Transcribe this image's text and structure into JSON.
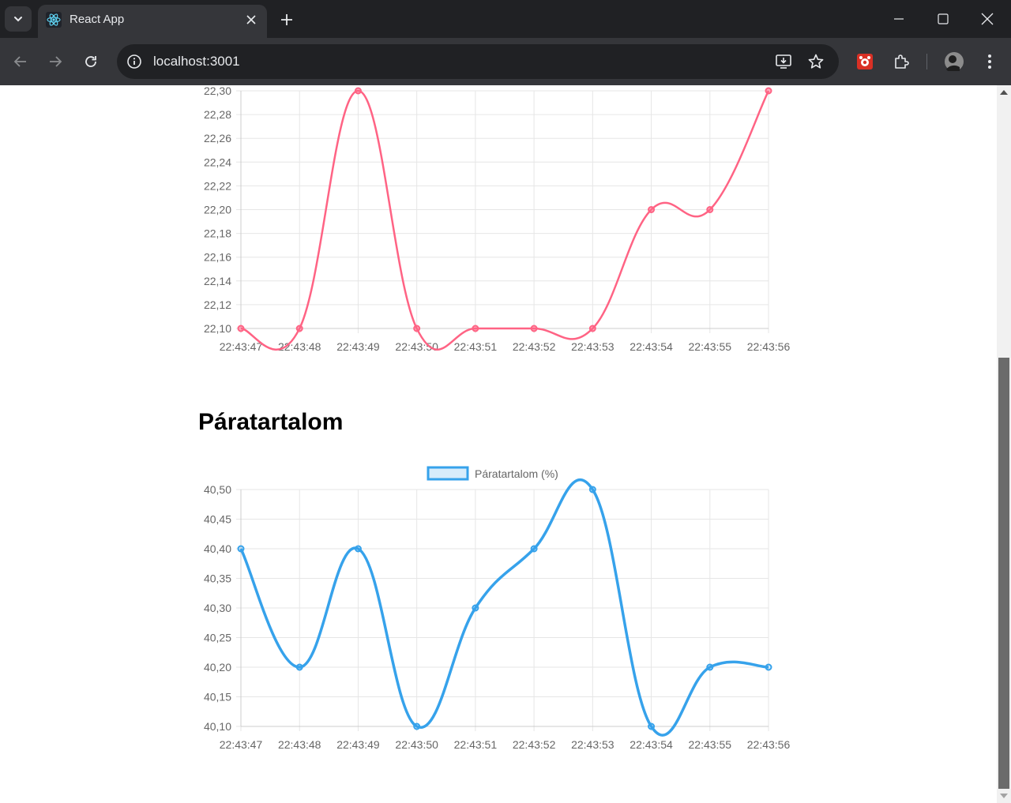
{
  "browser": {
    "tab_title": "React App",
    "url": "localhost:3001"
  },
  "icons": {
    "tab_search": "chevron-down-icon",
    "favicon": "react-icon",
    "tab_close": "close-icon",
    "new_tab": "plus-icon",
    "back": "arrow-left-icon",
    "forward": "arrow-right-icon",
    "reload": "reload-icon",
    "site_info": "info-icon",
    "install": "install-app-icon",
    "bookmark": "star-icon",
    "extension_red": "extension-icon",
    "extensions": "puzzle-icon",
    "profile": "avatar",
    "menu": "kebab-menu-icon"
  },
  "colors": {
    "temperature_line": "#ff6384",
    "humidity_line": "#36a2eb",
    "humidity_fill": "rgba(54,162,235,0.2)"
  },
  "section": {
    "humidity_heading": "Páratartalom"
  },
  "chart_data": [
    {
      "type": "line",
      "x": [
        "22:43:47",
        "22:43:48",
        "22:43:49",
        "22:43:50",
        "22:43:51",
        "22:43:52",
        "22:43:53",
        "22:43:54",
        "22:43:55",
        "22:43:56"
      ],
      "series": [
        {
          "values": [
            22.1,
            22.1,
            22.3,
            22.1,
            22.1,
            22.1,
            22.1,
            22.2,
            22.2,
            22.3
          ]
        }
      ],
      "y_ticks": [
        "22,30",
        "22,28",
        "22,26",
        "22,24",
        "22,22",
        "22,20",
        "22,18",
        "22,16",
        "22,14",
        "22,12",
        "22,10"
      ],
      "ylim": [
        22.1,
        22.3
      ],
      "grid": true
    },
    {
      "type": "line",
      "legend": "top-center",
      "x": [
        "22:43:47",
        "22:43:48",
        "22:43:49",
        "22:43:50",
        "22:43:51",
        "22:43:52",
        "22:43:53",
        "22:43:54",
        "22:43:55",
        "22:43:56"
      ],
      "series": [
        {
          "name": "Páratartalom (%)",
          "values": [
            40.4,
            40.2,
            40.4,
            40.1,
            40.3,
            40.4,
            40.5,
            40.1,
            40.2,
            40.2
          ]
        }
      ],
      "y_ticks": [
        "40,50",
        "40,45",
        "40,40",
        "40,35",
        "40,30",
        "40,25",
        "40,20",
        "40,15",
        "40,10"
      ],
      "ylim": [
        40.1,
        40.5
      ],
      "grid": true
    }
  ]
}
